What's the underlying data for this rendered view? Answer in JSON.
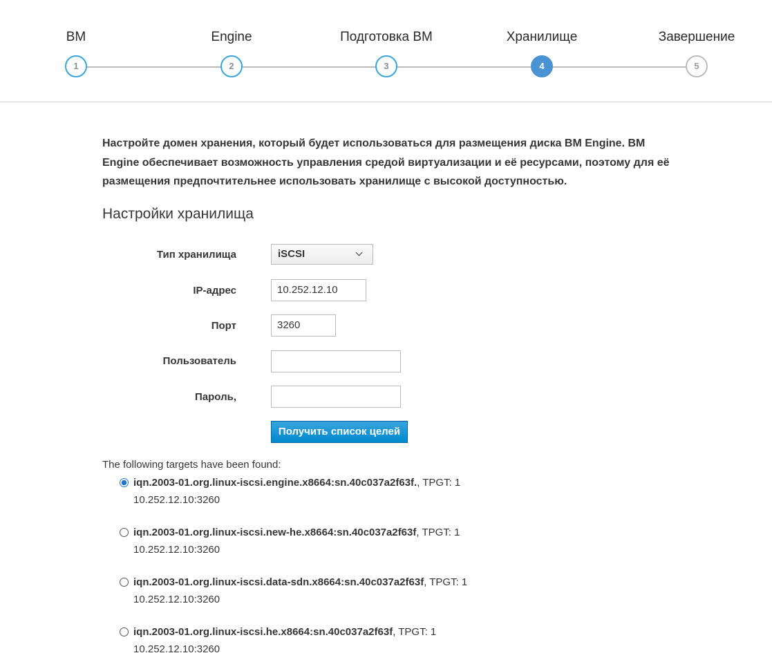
{
  "steps": [
    {
      "number": "1",
      "title": "ВМ"
    },
    {
      "number": "2",
      "title": "Engine"
    },
    {
      "number": "3",
      "title": "Подготовка ВМ"
    },
    {
      "number": "4",
      "title": "Хранилище"
    },
    {
      "number": "5",
      "title": "Завершение"
    }
  ],
  "active_step": 4,
  "intro": "Настройте домен хранения, который будет использоваться для размещения диска ВМ Engine. ВМ Engine обеспечивает возможность управления средой виртуализации и её ресурсами, поэтому для её размещения предпочтительнее использовать хранилище с высокой доступностью.",
  "section_title": "Настройки хранилища",
  "form": {
    "storage_type_label": "Тип хранилища",
    "storage_type_value": "iSCSI",
    "ip_label": "IP-адрес",
    "ip_value": "10.252.12.10",
    "port_label": "Порт",
    "port_value": "3260",
    "user_label": "Пользователь",
    "user_value": "",
    "password_label": "Пароль,",
    "password_value": "",
    "fetch_button": "Получить список целей"
  },
  "targets_header": "The following targets have been found:",
  "targets": [
    {
      "name": "iqn.2003-01.org.linux-iscsi.engine.x8664:sn.40c037a2f63f.",
      "tpgt": ", TPGT: 1",
      "address": "10.252.12.10:3260",
      "selected": true
    },
    {
      "name": "iqn.2003-01.org.linux-iscsi.new-he.x8664:sn.40c037a2f63f",
      "tpgt": ", TPGT: 1",
      "address": "10.252.12.10:3260",
      "selected": false
    },
    {
      "name": "iqn.2003-01.org.linux-iscsi.data-sdn.x8664:sn.40c037a2f63f",
      "tpgt": ", TPGT: 1",
      "address": "10.252.12.10:3260",
      "selected": false
    },
    {
      "name": "iqn.2003-01.org.linux-iscsi.he.x8664:sn.40c037a2f63f",
      "tpgt": ", TPGT: 1",
      "address": "10.252.12.10:3260",
      "selected": false
    }
  ],
  "colors": {
    "accent": "#39a5dc",
    "active_step": "#4a93d3",
    "primary_button": "#0088ce"
  }
}
